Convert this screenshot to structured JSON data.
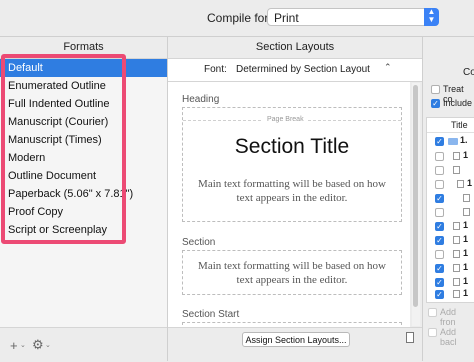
{
  "top": {
    "compile_label": "Compile for:",
    "compile_value": "Print",
    "compile_arrow_icon": "updown-chevron-icon"
  },
  "formats": {
    "header": "Formats",
    "items": [
      "Default",
      "Enumerated Outline",
      "Full Indented Outline",
      "Manuscript (Courier)",
      "Manuscript (Times)",
      "Modern",
      "Outline Document",
      "Paperback (5.06\" x 7.81\")",
      "Proof Copy",
      "Script or Screenplay"
    ],
    "selected_index": 0,
    "highlight_color": "#ec4a74",
    "add_icon": "plus-icon",
    "gear_icon": "gear-icon",
    "add_label": "+",
    "gear_label": "⚙"
  },
  "layouts": {
    "header": "Section Layouts",
    "font_label": "Font:",
    "font_value": "Determined by Section Layout",
    "sections": [
      {
        "label": "Heading",
        "page_break": "Page Break",
        "title": "Section Title",
        "body": "Main text formatting will be based on how text appears in the editor."
      },
      {
        "label": "Section",
        "body": "Main text formatting will be based on how text appears in the editor."
      },
      {
        "label": "Section Start"
      }
    ],
    "assign_button": "Assign Section Layouts..."
  },
  "right": {
    "header_fragment": "Co",
    "treat_fragment": "Treat co",
    "include_fragment": "Include",
    "list_title": "Title",
    "row_fragments": [
      "1.",
      "1",
      "",
      "1",
      "",
      "",
      "1",
      "1",
      "1",
      "1",
      "1",
      "1",
      "1"
    ],
    "add_front": "Add fron",
    "add_back": "Add bacl"
  }
}
